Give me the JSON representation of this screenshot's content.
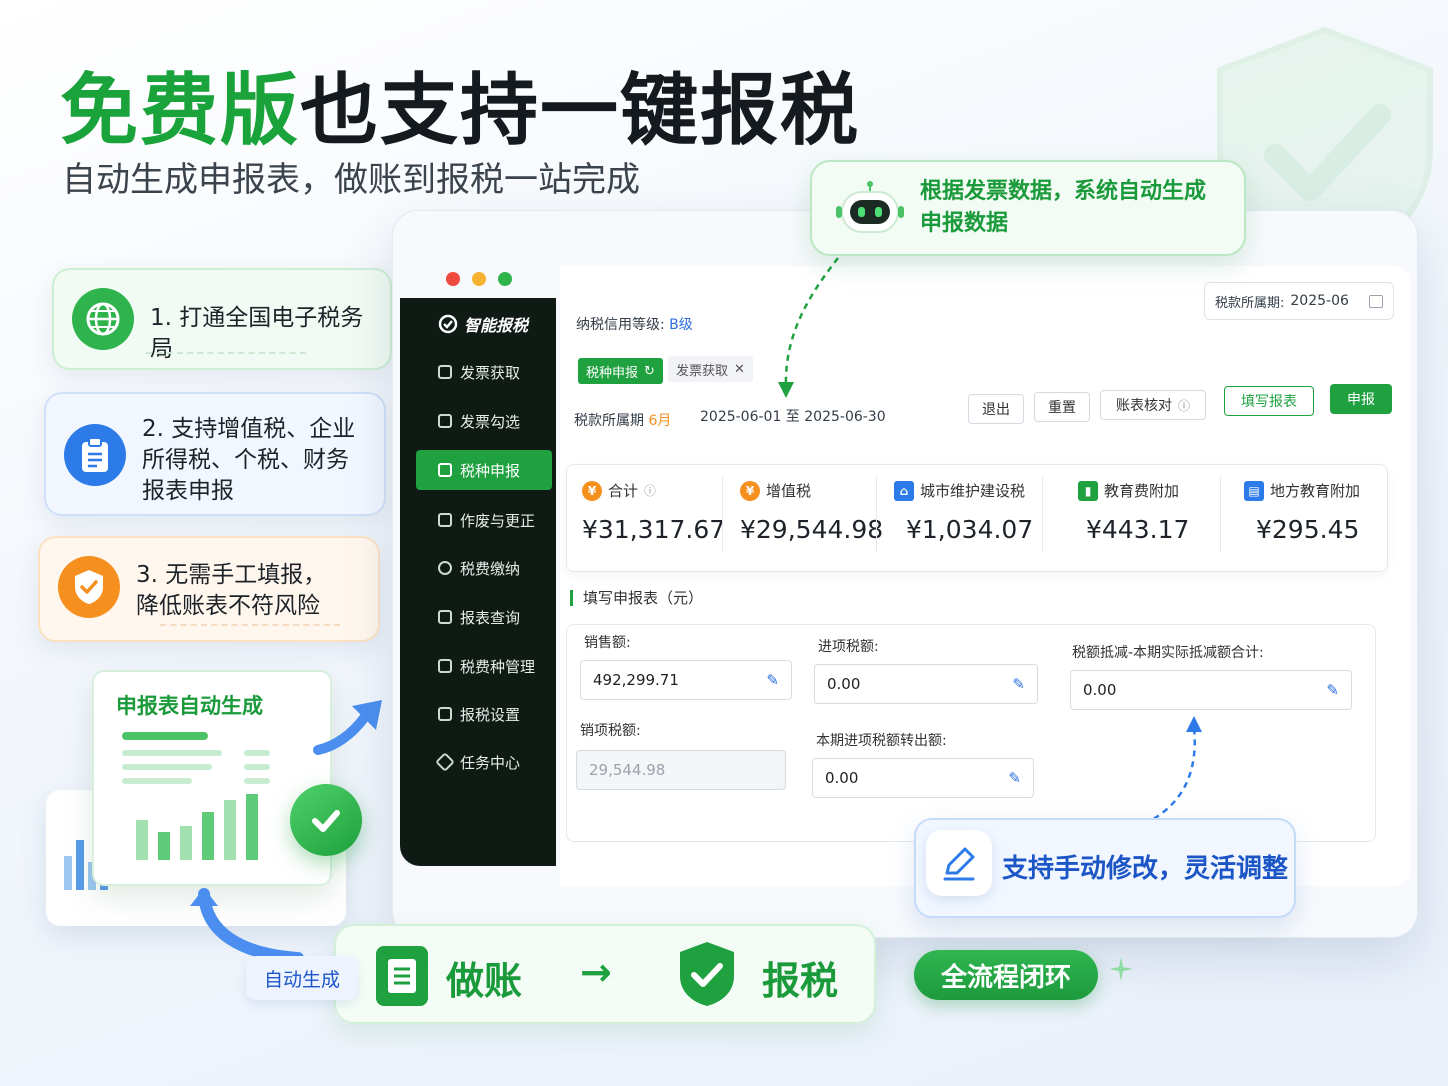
{
  "hero": {
    "title_green": "免费版",
    "title_dark": "也支持一键报税",
    "subtitle": "自动生成申报表，做账到报税一站完成"
  },
  "features": [
    {
      "text": "1. 打通全国电子税务局",
      "icon": "globe-icon",
      "color": "#2fb34d"
    },
    {
      "text": "2. 支持增值税、企业\n    所得税、个税、财务\n    报表申报",
      "icon": "clipboard-icon",
      "color": "#2d7be8"
    },
    {
      "text": "3. 无需手工填报，\n    降低账表不符风险",
      "icon": "shield-check-icon",
      "color": "#f5901e"
    }
  ],
  "illustration": {
    "doc_title": "申报表自动生成"
  },
  "callouts": {
    "top": "根据发票数据，系统自动生成\n申报数据",
    "bottom": "支持手动修改，灵活调整"
  },
  "app": {
    "logo": "智能报税",
    "sidebar": [
      {
        "label": "发票获取",
        "icon": "receipt-icon"
      },
      {
        "label": "发票勾选",
        "icon": "checkbox-icon"
      },
      {
        "label": "税种申报",
        "icon": "declare-icon",
        "active": true
      },
      {
        "label": "作废与更正",
        "icon": "edit-icon"
      },
      {
        "label": "税费缴纳",
        "icon": "pay-icon"
      },
      {
        "label": "报表查询",
        "icon": "report-icon"
      },
      {
        "label": "税费种管理",
        "icon": "manage-icon"
      },
      {
        "label": "报税设置",
        "icon": "settings-icon"
      },
      {
        "label": "任务中心",
        "icon": "task-icon"
      }
    ],
    "credit_label": "纳税信用等级:",
    "credit_value": "B级",
    "period_label_top": "税款所属期:",
    "period_value_top": "2025-06",
    "tabs": [
      {
        "label": "税种申报",
        "active": true
      },
      {
        "label": "发票获取",
        "active": false
      }
    ],
    "period_label": "税款所属期",
    "period_month": "6月",
    "period_range": "2025-06-01 至 2025-06-30",
    "buttons": {
      "exit": "退出",
      "reset": "重置",
      "check": "账表核对",
      "fill": "填写报表",
      "declare": "申报"
    },
    "summary": [
      {
        "label": "合计",
        "value": "¥31,317.67",
        "icon": "total-icon",
        "color": "#f5901e"
      },
      {
        "label": "增值税",
        "value": "¥29,544.98",
        "icon": "vat-icon",
        "color": "#f5901e"
      },
      {
        "label": "城市维护建设税",
        "value": "¥1,034.07",
        "icon": "house-icon",
        "color": "#2d7be8"
      },
      {
        "label": "教育费附加",
        "value": "¥443.17",
        "icon": "book-icon",
        "color": "#1fa140"
      },
      {
        "label": "地方教育附加",
        "value": "¥295.45",
        "icon": "local-edu-icon",
        "color": "#2d7be8"
      }
    ],
    "form_title": "填写申报表（元）",
    "form": {
      "sales_label": "销售额:",
      "sales_value": "492,299.71",
      "input_tax_label": "进项税额:",
      "input_tax_value": "0.00",
      "deduction_label": "税额抵减-本期实际抵减额合计:",
      "deduction_value": "0.00",
      "output_tax_label": "销项税额:",
      "output_tax_value": "29,544.98",
      "transfer_label": "本期进项税额转出额:",
      "transfer_value": "0.00"
    }
  },
  "bottom": {
    "auto_label": "自动生成",
    "bookkeeping": "做账",
    "arrow": "→",
    "tax": "报税",
    "loop": "全流程闭环"
  }
}
